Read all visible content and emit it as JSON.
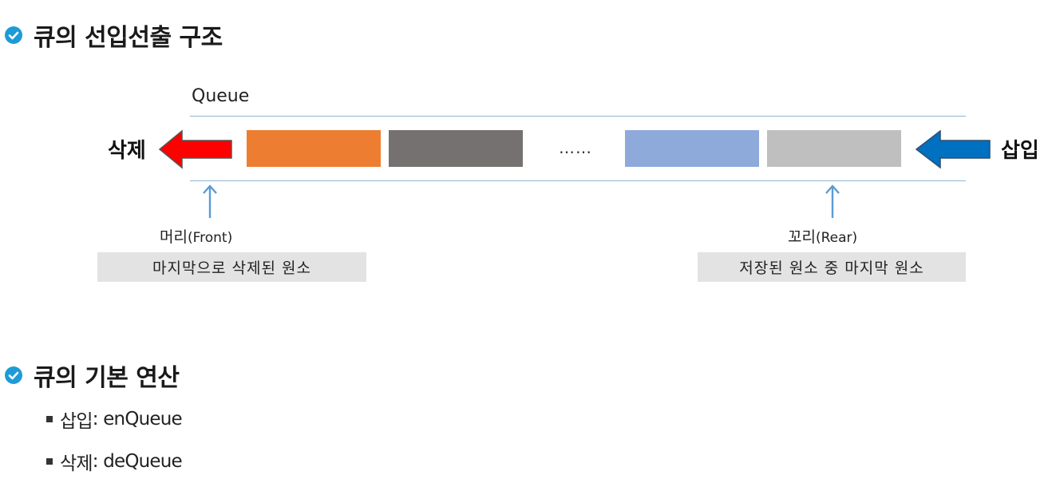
{
  "colors": {
    "check_icon": "#1e9bd7",
    "arrow_delete": "#ff0000",
    "arrow_insert": "#0070c0",
    "pointer_arrow": "#5b9bd5",
    "line": "#8fb4d3"
  },
  "section1": {
    "title": "큐의 선입선출 구조",
    "icon": "check-circle-icon"
  },
  "diagram": {
    "queue_label": "Queue",
    "delete_label": "삭제",
    "insert_label": "삽입",
    "ellipsis": "……",
    "cells": [
      {
        "name": "cell-1",
        "color": "#ed7d31"
      },
      {
        "name": "cell-2",
        "color": "#767171"
      },
      {
        "name": "cell-3",
        "color": "#8eaadb"
      },
      {
        "name": "cell-4",
        "color": "#bfbfbf"
      }
    ],
    "front": {
      "label": "머리",
      "label_en": "(Front)",
      "description": "마지막으로 삭제된 원소"
    },
    "rear": {
      "label": "꼬리",
      "label_en": "(Rear)",
      "description": "저장된 원소 중 마지막 원소"
    }
  },
  "section2": {
    "title": "큐의 기본 연산",
    "icon": "check-circle-icon",
    "bullets": [
      {
        "label": "삽입",
        "op": " : enQueue"
      },
      {
        "label": "삭제",
        "op": " : deQueue"
      }
    ]
  }
}
